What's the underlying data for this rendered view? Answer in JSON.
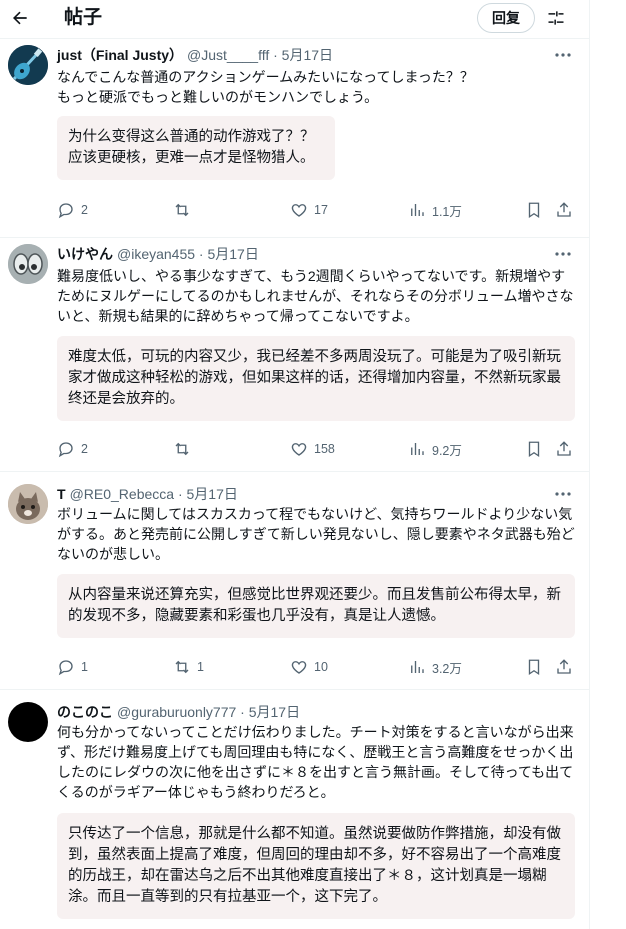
{
  "header": {
    "title": "帖子",
    "reply_label": "回复"
  },
  "posts": [
    {
      "name": "just（Final Justy）",
      "handle": "@Just____fff · 5月17日",
      "text": "なんでこんな普通のアクションゲームみたいになってしまった？？\nもっと硬派でもっと難しいのがモンハンでしょう。",
      "translation": "为什么变得这么普通的动作游戏了？？\n应该更硬核，更难一点才是怪物猎人。",
      "replies": "2",
      "reposts": "",
      "likes": "17",
      "views": "1.1万"
    },
    {
      "name": "いけやん",
      "handle": "@ikeyan455 · 5月17日",
      "text": "難易度低いし、やる事少なすぎて、もう2週間くらいやってないです。新規増やすためにヌルゲーにしてるのかもしれませんが、それならその分ボリューム増やさないと、新規も結果的に辞めちゃって帰ってこないですよ。",
      "translation": "难度太低，可玩的内容又少，我已经差不多两周没玩了。可能是为了吸引新玩家才做成这种轻松的游戏，但如果这样的话，还得增加内容量，不然新玩家最终还是会放弃的。",
      "replies": "2",
      "reposts": "",
      "likes": "158",
      "views": "9.2万"
    },
    {
      "name": "T",
      "handle": "@RE0_Rebecca · 5月17日",
      "text": "ボリュームに関してはスカスカって程でもないけど、気持ちワールドより少ない気がする。あと発売前に公開しすぎて新しい発見ないし、隠し要素やネタ武器も殆どないのが悲しい。",
      "translation": "从内容量来说还算充实，但感觉比世界观还要少。而且发售前公布得太早，新的发现不多，隐藏要素和彩蛋也几乎没有，真是让人遗憾。",
      "replies": "1",
      "reposts": "1",
      "likes": "10",
      "views": "3.2万"
    },
    {
      "name": "のこのこ",
      "handle": "@guraburuonly777 · 5月17日",
      "text": "何も分かってないってことだけ伝わりました。チート対策をすると言いながら出来ず、形だけ難易度上げても周回理由も特になく、歴戦王と言う高難度をせっかく出したのにレダウの次に他を出さずに＊８を出すと言う無計画。そして待っても出てくるのがラギアー体じゃもう終わりだろと。",
      "translation": "只传达了一个信息，那就是什么都不知道。虽然说要做防作弊措施，却没有做到，虽然表面上提高了难度，但周回的理由却不多，好不容易出了一个高难度的历战王，却在雷达乌之后不出其他难度直接出了＊８，这计划真是一塌糊涂。而且一直等到的只有拉基亚一个，这下完了。",
      "replies": "",
      "reposts": "",
      "likes": "",
      "views": ""
    }
  ]
}
